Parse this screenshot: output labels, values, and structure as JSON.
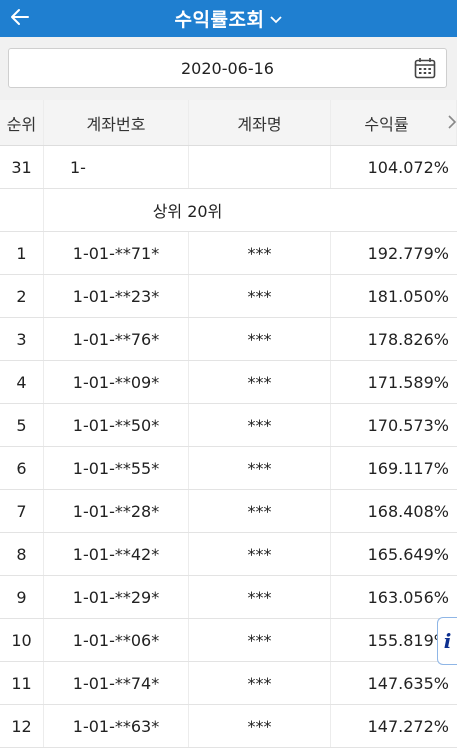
{
  "appbar": {
    "title": "수익률조회",
    "back_icon": "arrow-left-icon",
    "dropdown_icon": "chevron-down-icon",
    "color": "#1f7fd0"
  },
  "date_filter": {
    "value": "2020-06-16",
    "icon": "calendar-icon"
  },
  "table": {
    "headers": {
      "rank": "순위",
      "account": "계좌번호",
      "name": "계좌명",
      "rate": "수익률"
    },
    "my_row": {
      "rank": "31",
      "account": "1-",
      "name": "",
      "rate": "104.072%"
    },
    "section_label": "상위 20위",
    "rows": [
      {
        "rank": "1",
        "account": "1-01-**71*",
        "name": "***",
        "rate": "192.779%"
      },
      {
        "rank": "2",
        "account": "1-01-**23*",
        "name": "***",
        "rate": "181.050%"
      },
      {
        "rank": "3",
        "account": "1-01-**76*",
        "name": "***",
        "rate": "178.826%"
      },
      {
        "rank": "4",
        "account": "1-01-**09*",
        "name": "***",
        "rate": "171.589%"
      },
      {
        "rank": "5",
        "account": "1-01-**50*",
        "name": "***",
        "rate": "170.573%"
      },
      {
        "rank": "6",
        "account": "1-01-**55*",
        "name": "***",
        "rate": "169.117%"
      },
      {
        "rank": "7",
        "account": "1-01-**28*",
        "name": "***",
        "rate": "168.408%"
      },
      {
        "rank": "8",
        "account": "1-01-**42*",
        "name": "***",
        "rate": "165.649%"
      },
      {
        "rank": "9",
        "account": "1-01-**29*",
        "name": "***",
        "rate": "163.056%"
      },
      {
        "rank": "10",
        "account": "1-01-**06*",
        "name": "***",
        "rate": "155.819%"
      },
      {
        "rank": "11",
        "account": "1-01-**74*",
        "name": "***",
        "rate": "147.635%"
      },
      {
        "rank": "12",
        "account": "1-01-**63*",
        "name": "***",
        "rate": "147.272%"
      }
    ]
  },
  "info_button": {
    "label": "i",
    "icon": "info-icon"
  }
}
